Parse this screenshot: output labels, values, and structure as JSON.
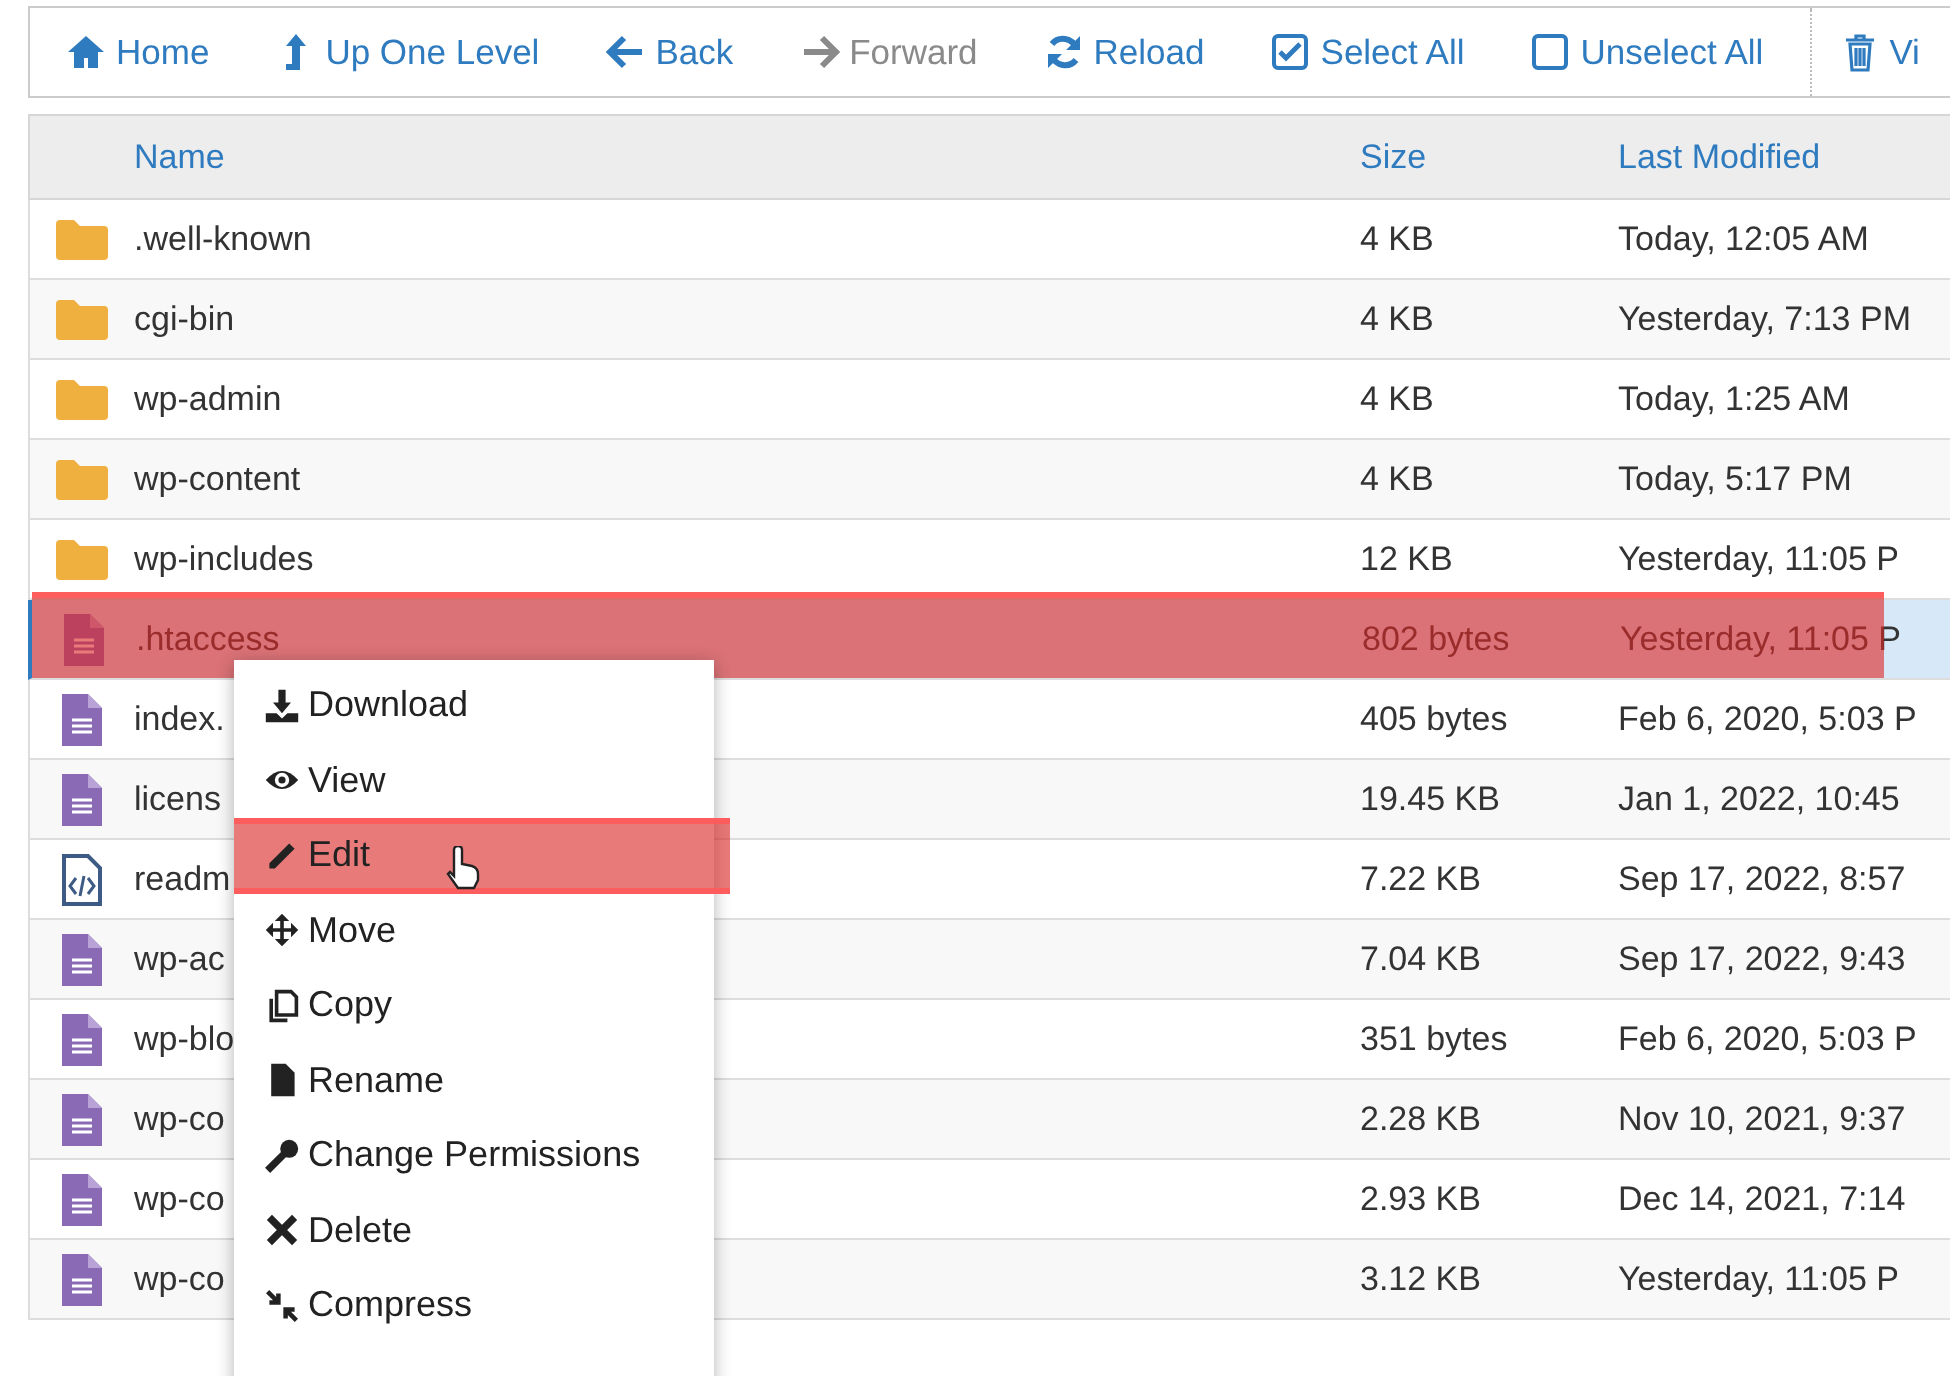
{
  "toolbar": [
    {
      "label": "Home",
      "disabled": false
    },
    {
      "label": "Up One Level",
      "disabled": false
    },
    {
      "label": "Back",
      "disabled": false
    },
    {
      "label": "Forward",
      "disabled": true
    },
    {
      "label": "Reload",
      "disabled": false
    },
    {
      "label": "Select All",
      "disabled": false
    },
    {
      "label": "Unselect All",
      "disabled": false
    },
    {
      "label": "Vi",
      "disabled": false
    }
  ],
  "table": {
    "columns": [
      "Name",
      "Size",
      "Last Modified"
    ],
    "rows": [
      {
        "kind": "folder",
        "name": ".well-known",
        "size": "4 KB",
        "modified": "Today, 12:05 AM",
        "selected": false,
        "highlighted": false
      },
      {
        "kind": "folder",
        "name": "cgi-bin",
        "size": "4 KB",
        "modified": "Yesterday, 7:13 PM",
        "selected": false,
        "highlighted": false
      },
      {
        "kind": "folder",
        "name": "wp-admin",
        "size": "4 KB",
        "modified": "Today, 1:25 AM",
        "selected": false,
        "highlighted": false
      },
      {
        "kind": "folder",
        "name": "wp-content",
        "size": "4 KB",
        "modified": "Today, 5:17 PM",
        "selected": false,
        "highlighted": false
      },
      {
        "kind": "folder",
        "name": "wp-includes",
        "size": "12 KB",
        "modified": "Yesterday, 11:05 P",
        "selected": false,
        "highlighted": false
      },
      {
        "kind": "file",
        "name": ".htaccess",
        "size": "802 bytes",
        "modified": "Yesterday, 11:05 P",
        "selected": true,
        "highlighted": true
      },
      {
        "kind": "file",
        "name": "index.",
        "size": "405 bytes",
        "modified": "Feb 6, 2020, 5:03 P",
        "selected": false,
        "highlighted": false
      },
      {
        "kind": "file",
        "name": "licens",
        "size": "19.45 KB",
        "modified": "Jan 1, 2022, 10:45",
        "selected": false,
        "highlighted": false
      },
      {
        "kind": "code",
        "name": "readm",
        "size": "7.22 KB",
        "modified": "Sep 17, 2022, 8:57",
        "selected": false,
        "highlighted": false
      },
      {
        "kind": "file",
        "name": "wp-ac",
        "size": "7.04 KB",
        "modified": "Sep 17, 2022, 9:43",
        "selected": false,
        "highlighted": false
      },
      {
        "kind": "file",
        "name": "wp-blo",
        "size": "351 bytes",
        "modified": "Feb 6, 2020, 5:03 P",
        "selected": false,
        "highlighted": false
      },
      {
        "kind": "file",
        "name": "wp-co",
        "size": "2.28 KB",
        "modified": "Nov 10, 2021, 9:37",
        "selected": false,
        "highlighted": false
      },
      {
        "kind": "file",
        "name": "wp-co",
        "size": "2.93 KB",
        "modified": "Dec 14, 2021, 7:14",
        "selected": false,
        "highlighted": false
      },
      {
        "kind": "file",
        "name": "wp-co",
        "size": "3.12 KB",
        "modified": "Yesterday, 11:05 P",
        "selected": false,
        "highlighted": false
      }
    ]
  },
  "context_menu": {
    "items": [
      {
        "label": "Download",
        "highlighted": false
      },
      {
        "label": "View",
        "highlighted": false
      },
      {
        "label": "Edit",
        "highlighted": true
      },
      {
        "label": "Move",
        "highlighted": false
      },
      {
        "label": "Copy",
        "highlighted": false
      },
      {
        "label": "Rename",
        "highlighted": false
      },
      {
        "label": "Change Permissions",
        "highlighted": false
      },
      {
        "label": "Delete",
        "highlighted": false
      },
      {
        "label": "Compress",
        "highlighted": false
      }
    ]
  }
}
